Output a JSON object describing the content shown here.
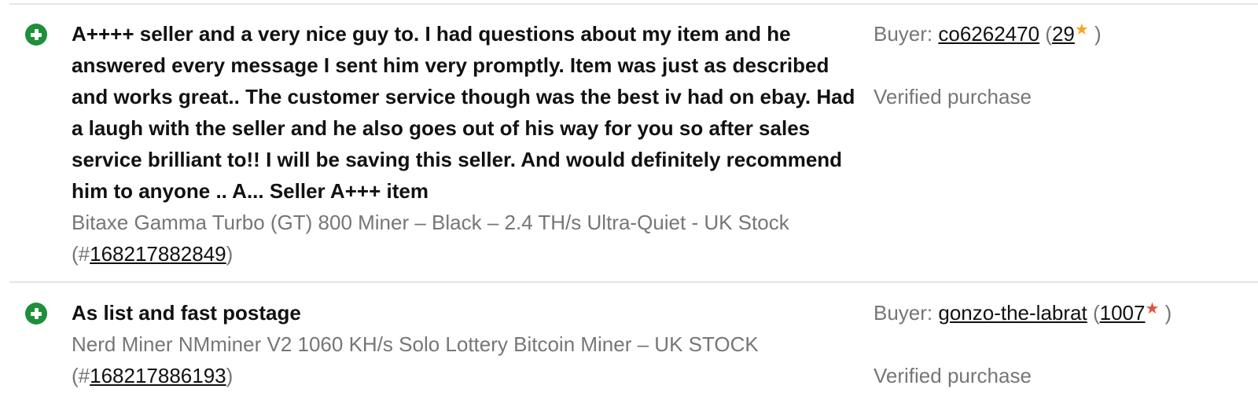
{
  "feedback": [
    {
      "comment": "A++++ seller and a very nice guy to. I had questions about my item and he answered every message I sent him very promptly. Item was just as described and works great.. The customer service though was the best iv had on ebay. Had a laugh with the seller and he also goes out of his way for you so after sales service brilliant to!! I will be saving this seller. And would definitely recommend him to anyone .. A... Seller A+++ item",
      "item_title": "Bitaxe Gamma Turbo (GT) 800 Miner – Black – 2.4 TH/s Ultra-Quiet - UK Stock",
      "item_prefix": "(#",
      "item_number": "168217882849",
      "item_suffix": ")",
      "buyer_label": "Buyer: ",
      "buyer_name": "co6262470",
      "score_open": " (",
      "buyer_score": "29",
      "star": "★",
      "star_color": "#f5a623",
      "score_close": " )",
      "verified": "Verified purchase"
    },
    {
      "comment": "As list and fast postage",
      "item_title": "Nerd Miner NMminer V2 1060 KH/s Solo Lottery Bitcoin Miner – UK STOCK",
      "item_prefix": "(#",
      "item_number": "168217886193",
      "item_suffix": ")",
      "buyer_label": "Buyer: ",
      "buyer_name": "gonzo-the-labrat",
      "score_open": " (",
      "buyer_score": "1007",
      "star": "★",
      "star_color": "#e0533c",
      "score_close": " )",
      "verified": "Verified purchase"
    }
  ],
  "colors": {
    "positive_icon": "#1e8f3a",
    "secondary_text": "#767676",
    "divider": "#e5e5e5"
  },
  "icons": {
    "positive": "plus-circle-icon"
  }
}
